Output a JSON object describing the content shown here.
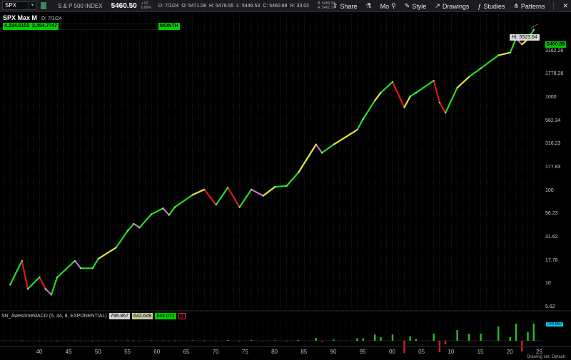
{
  "toolbar": {
    "symbol": "SPX",
    "index_name": "S & P 500 INDEX",
    "last_price": "5460.50",
    "change": [
      "+.02",
      "0.00%"
    ],
    "ohlc": [
      "D: 7/1/24",
      "O: 5471.08",
      "H: 5479.55",
      "L: 5446.53",
      "C: 5460.89",
      "R: 33.02"
    ],
    "bid_ask": [
      "B: 5459.34",
      "A: 5461.72"
    ],
    "share_label": "Share",
    "mo_label": "Mo",
    "style_label": "Style",
    "drawings_label": "Drawings",
    "studies_label": "Studies",
    "patterns_label": "Patterns"
  },
  "chart_header": {
    "title": "SPX Max M",
    "date": "D: 7/1/24",
    "box1": "4,234.6102",
    "box2": "2,454.7747",
    "aggregation": "MONTH"
  },
  "price_axis": {
    "labels": [
      "3162.28",
      "1778.28",
      "1000",
      "562.34",
      "316.23",
      "177.83",
      "100",
      "56.23",
      "31.62",
      "17.78",
      "10",
      "5.62"
    ],
    "current": "5460.89",
    "high_label": "Hi: 5523.64"
  },
  "indicator": {
    "name": "SN_AwesomeMACD (5, 34, 8, EXPONENTIAL)",
    "values": [
      "799.867",
      "642.649",
      "844.071",
      "0"
    ],
    "current": "799.867"
  },
  "time_axis": [
    "40",
    "45",
    "50",
    "55",
    "60",
    "65",
    "70",
    "75",
    "80",
    "85",
    "90",
    "95",
    "00",
    "05",
    "10",
    "15",
    "20",
    "25"
  ],
  "status": "Drawing set: Default",
  "colors": {
    "up_strong": "#22dd22",
    "up_weak": "#e6e63a",
    "down_strong": "#e01818",
    "down_weak": "#d066d0",
    "price_tag": "#00c800"
  },
  "chart_data": {
    "type": "line",
    "title": "SPX Max M",
    "scale": "log",
    "ylim": [
      5.62,
      5623.41
    ],
    "xlim": [
      1934,
      2025
    ],
    "series": [
      {
        "name": "SPX",
        "x": [
          1935,
          1937,
          1938,
          1940,
          1941,
          1942,
          1943,
          1946,
          1947,
          1949,
          1950,
          1953,
          1955,
          1956,
          1957,
          1959,
          1961,
          1962,
          1963,
          1966,
          1968,
          1970,
          1972,
          1974,
          1976,
          1978,
          1980,
          1982,
          1984,
          1987,
          1988,
          1990,
          1994,
          1995,
          1997,
          1998,
          2000,
          2002,
          2003,
          2004,
          2007,
          2008,
          2009,
          2011,
          2013,
          2015,
          2018,
          2020,
          2021,
          2022,
          2023,
          2024
        ],
        "y": [
          10,
          18,
          9,
          12,
          9,
          7.8,
          12,
          18,
          15,
          15,
          19,
          25,
          38,
          45,
          41,
          57,
          66,
          56,
          68,
          92,
          105,
          72,
          110,
          68,
          105,
          90,
          112,
          115,
          160,
          320,
          260,
          320,
          460,
          600,
          950,
          1150,
          1500,
          800,
          1050,
          1150,
          1550,
          900,
          700,
          1300,
          1700,
          2100,
          2900,
          3100,
          4400,
          3800,
          4300,
          5460.89
        ]
      }
    ],
    "indicator": {
      "name": "SN_AwesomeMACD (5, 34, 8, EXPONENTIAL)",
      "values": [
        799.867,
        642.649,
        844.071,
        0
      ]
    }
  }
}
